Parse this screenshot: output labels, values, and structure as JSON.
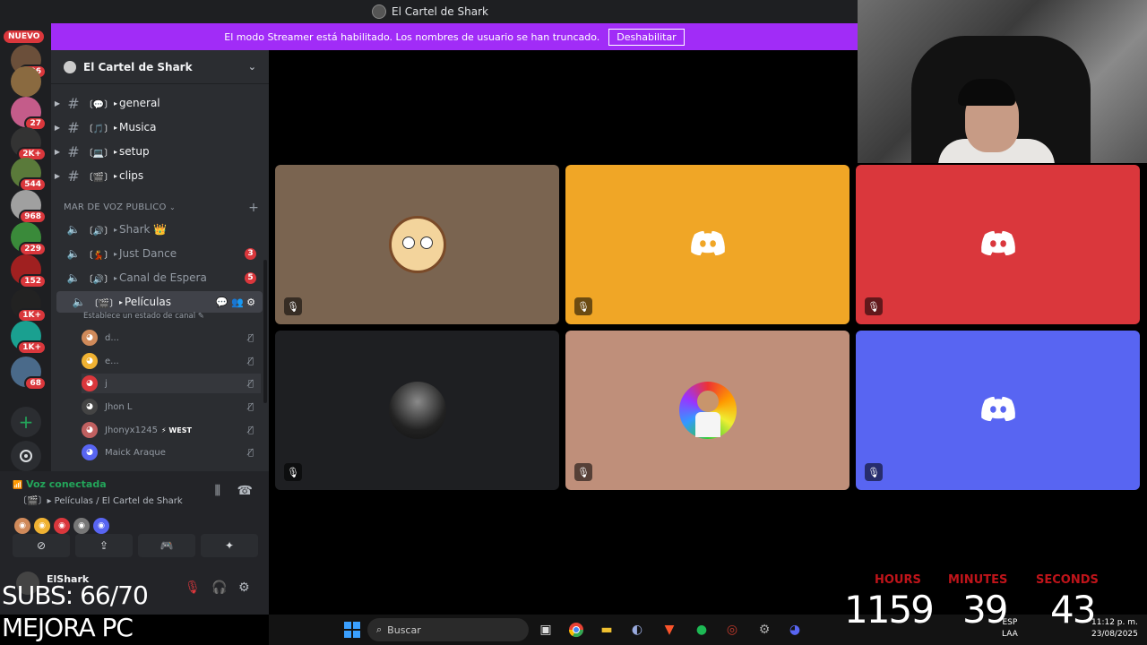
{
  "window": {
    "title": "El Cartel de Shark"
  },
  "banner": {
    "text": "El modo Streamer está habilitado. Los nombres de usuario se han truncado.",
    "button": "Deshabilitar"
  },
  "rail": {
    "new_label": "NUEVO",
    "servers": [
      {
        "badge": "106",
        "color": "#6b4f3a"
      },
      {
        "badge": "",
        "color": "#8a6a40"
      },
      {
        "badge": "27",
        "color": "#c45c8a"
      },
      {
        "badge": "2K+",
        "color": "#333333"
      },
      {
        "badge": "544",
        "color": "#5a7a3a"
      },
      {
        "badge": "968",
        "color": "#a0a0a0"
      },
      {
        "badge": "229",
        "color": "#3a8a3a"
      },
      {
        "badge": "152",
        "color": "#a02020"
      },
      {
        "badge": "1K+",
        "color": "#222222"
      },
      {
        "badge": "1K+",
        "color": "#1aa090"
      },
      {
        "badge": "68",
        "color": "#4a6a8a"
      }
    ],
    "add_icon": "+",
    "discover_icon": "compass-icon"
  },
  "sidebar": {
    "guild_name": "El Cartel de Shark",
    "text_channels": [
      {
        "emoji": "〔💬〕",
        "name": "general"
      },
      {
        "emoji": "〔🎵〕",
        "name": "Musica"
      },
      {
        "emoji": "〔💻〕",
        "name": "setup"
      },
      {
        "emoji": "〔🎬〕",
        "name": "clips"
      }
    ],
    "category": "MAR DE VOZ PUBLICO",
    "voice_channels": [
      {
        "emoji": "〔🔊〕",
        "name": "Shark 👑",
        "count": ""
      },
      {
        "emoji": "〔💃〕",
        "name": "Just Dance",
        "count": "3"
      },
      {
        "emoji": "〔🔊〕",
        "name": "Canal de Espera",
        "count": "5"
      },
      {
        "emoji": "〔🎬〕",
        "name": "Películas",
        "count": ""
      }
    ],
    "status_hint": "Establece un estado de canal ✎",
    "voice_users": [
      {
        "name": "d...",
        "color": "#d08a5a"
      },
      {
        "name": "e...",
        "color": "#f0b232"
      },
      {
        "name": "j",
        "color": "#da373c"
      },
      {
        "name": "Jhon L",
        "color": "#444444"
      },
      {
        "name": "Jhonyx1245",
        "color": "#c06060",
        "tag": "⚡ WEST"
      },
      {
        "name": "Maick Araque",
        "color": "#5865f2"
      }
    ]
  },
  "voice_panel": {
    "status": "Voz conectada",
    "channel": "〔🎬〕▸ Películas / El Cartel de Shark",
    "username": "ElShark"
  },
  "tiles": [
    {
      "bg": "#7a6450",
      "kind": "avatar-morty"
    },
    {
      "bg": "#f0a626",
      "kind": "discord"
    },
    {
      "bg": "#da373c",
      "kind": "discord"
    },
    {
      "bg": "#1e1f22",
      "kind": "avatar-dark"
    },
    {
      "bg": "#bf8f7a",
      "kind": "avatar-kid"
    },
    {
      "bg": "#5865f2",
      "kind": "discord"
    }
  ],
  "overlay": {
    "subs": "SUBS: 66/70",
    "mejora": "MEJORA PC",
    "hours_label": "HOURS",
    "hours": "1159",
    "minutes_label": "MINUTES",
    "minutes": "39",
    "seconds_label": "SECONDS",
    "seconds": "43"
  },
  "taskbar": {
    "search": "Buscar",
    "lang": "ESP",
    "lang2": "LAA",
    "time": "11:12 p. m.",
    "date": "23/08/2025"
  }
}
